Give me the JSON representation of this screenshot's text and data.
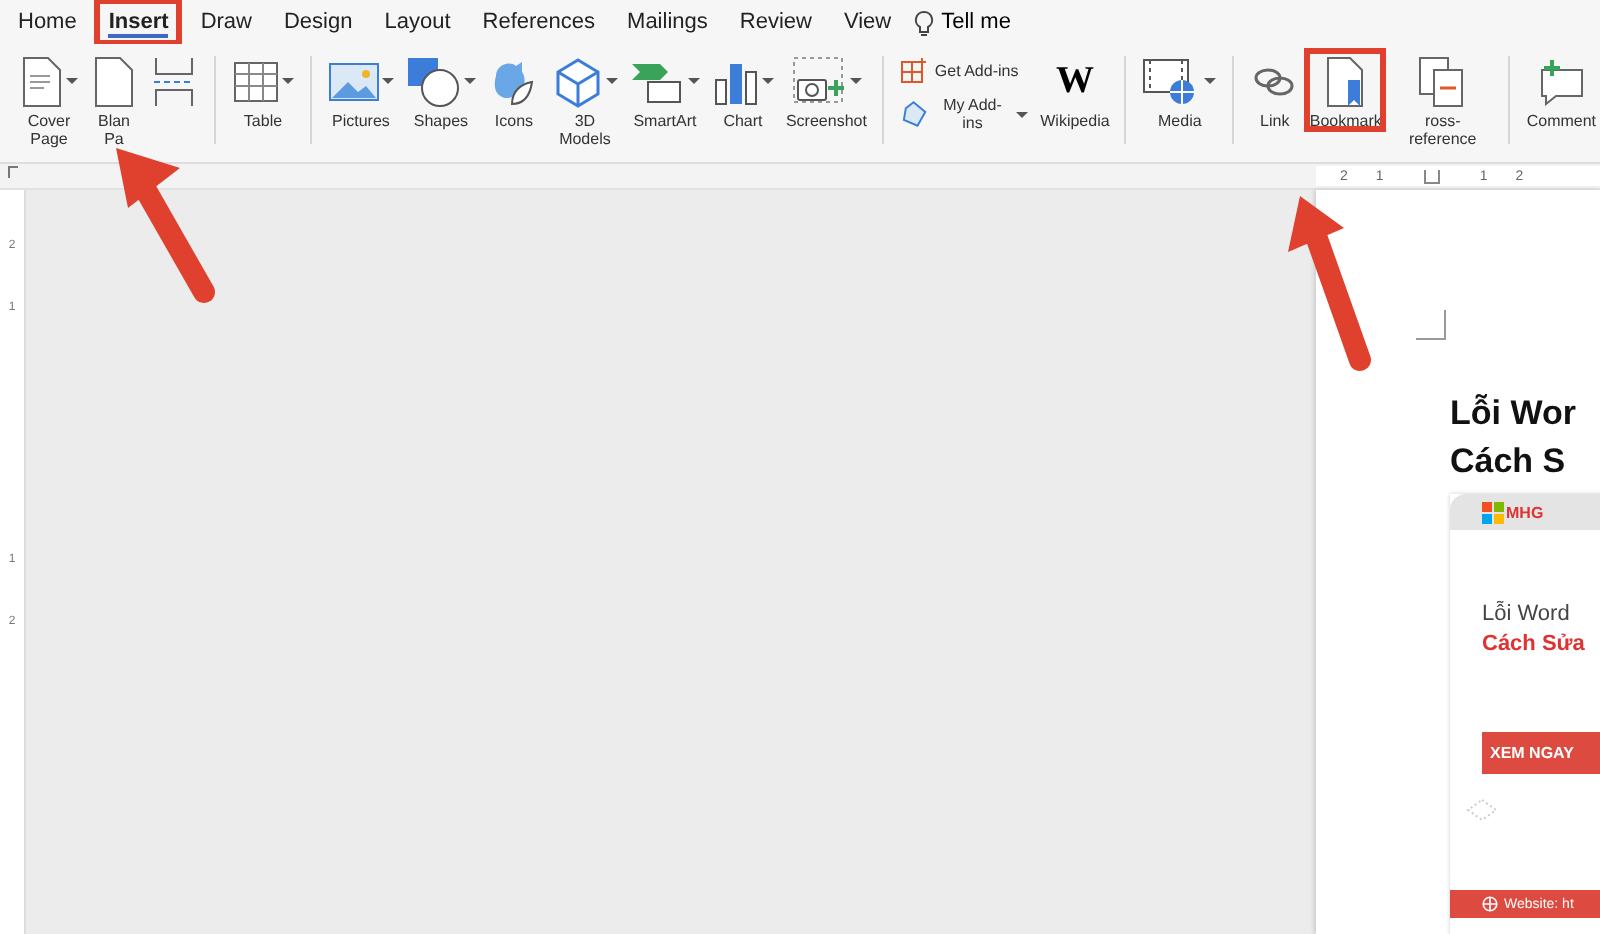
{
  "tabs": [
    {
      "label": "Home",
      "selected": false,
      "highlighted": false
    },
    {
      "label": "Insert",
      "selected": true,
      "highlighted": true
    },
    {
      "label": "Draw",
      "selected": false,
      "highlighted": false
    },
    {
      "label": "Design",
      "selected": false,
      "highlighted": false
    },
    {
      "label": "Layout",
      "selected": false,
      "highlighted": false
    },
    {
      "label": "References",
      "selected": false,
      "highlighted": false
    },
    {
      "label": "Mailings",
      "selected": false,
      "highlighted": false
    },
    {
      "label": "Review",
      "selected": false,
      "highlighted": false
    },
    {
      "label": "View",
      "selected": false,
      "highlighted": false
    }
  ],
  "tell_me": "Tell me",
  "ribbon_groups": [
    {
      "items": [
        {
          "kind": "big",
          "label": "Cover\nPage",
          "dropdown": true,
          "highlighted": false
        },
        {
          "kind": "big",
          "label": "Blan\nPa",
          "dropdown": false,
          "highlighted": false
        },
        {
          "kind": "big",
          "dropdown": false,
          "highlighted": false
        }
      ]
    },
    {
      "items": [
        {
          "kind": "big",
          "label": "Table",
          "dropdown": true,
          "highlighted": false
        }
      ]
    },
    {
      "items": [
        {
          "kind": "big",
          "label": "Pictures",
          "dropdown": true,
          "highlighted": false
        },
        {
          "kind": "big",
          "label": "Shapes",
          "dropdown": true,
          "highlighted": false
        },
        {
          "kind": "big",
          "label": "Icons",
          "dropdown": false,
          "highlighted": false
        },
        {
          "kind": "big",
          "label": "3D\nModels",
          "dropdown": true,
          "highlighted": false
        },
        {
          "kind": "big",
          "label": "SmartArt",
          "dropdown": true,
          "highlighted": false
        },
        {
          "kind": "big",
          "label": "Chart",
          "dropdown": true,
          "highlighted": false
        },
        {
          "kind": "big",
          "label": "Screenshot",
          "dropdown": true,
          "highlighted": false
        }
      ]
    },
    {
      "items": [
        {
          "kind": "small",
          "label": "Get Add-ins",
          "dropdown": false,
          "highlighted": false
        },
        {
          "kind": "small",
          "label": "My Add-ins",
          "dropdown": true,
          "highlighted": false
        },
        {
          "kind": "big",
          "label": "Wikipedia",
          "glyph": "W",
          "dropdown": false,
          "highlighted": false
        }
      ]
    },
    {
      "items": [
        {
          "kind": "big",
          "label": "Media",
          "dropdown": true,
          "highlighted": false
        }
      ]
    },
    {
      "items": [
        {
          "kind": "big",
          "label": "Link",
          "dropdown": false,
          "highlighted": false
        },
        {
          "kind": "big",
          "label": "Bookmark",
          "dropdown": false,
          "highlighted": true
        },
        {
          "kind": "big",
          "label": "ross-reference",
          "dropdown": false,
          "highlighted": false
        }
      ]
    },
    {
      "items": [
        {
          "kind": "big",
          "label": "Comment",
          "dropdown": false,
          "highlighted": false
        }
      ]
    }
  ],
  "ruler": {
    "left_numbers": [
      "2",
      "1"
    ],
    "right_numbers": [
      "1",
      "2"
    ]
  },
  "vertical_ruler": {
    "numbers": [
      "2",
      "1",
      "1",
      "2"
    ]
  },
  "document": {
    "title_lines": [
      "Lỗi Wor",
      "Cách S"
    ],
    "banner": {
      "logo": "MHG",
      "line_1": "Lỗi Word",
      "line_2": "Cách Sửa",
      "button": "XEM NGAY",
      "footer": "Website: ht"
    }
  }
}
